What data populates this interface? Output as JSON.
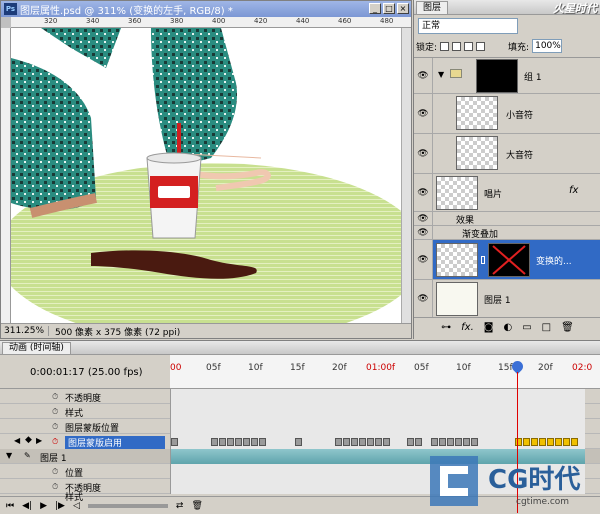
{
  "document": {
    "title": "图层属性.psd @ 311% (变换的左手, RGB/8) *",
    "app_icon": "Ps",
    "ruler_top_labels": [
      "320",
      "340",
      "360",
      "380",
      "400",
      "420",
      "440",
      "460",
      "480"
    ],
    "zoom": "311.25%",
    "status_info": "500 像素 x 375 像素 (72 ppi)"
  },
  "layers_panel": {
    "tab": "图层",
    "logo": "火星时代",
    "blend_mode": "正常",
    "lock_label": "锁定:",
    "fill_label": "填充:",
    "fill_value": "100%",
    "layers": [
      {
        "name": "组 1"
      },
      {
        "name": "小音符"
      },
      {
        "name": "大音符"
      },
      {
        "name": "唱片"
      },
      {
        "name": "效果"
      },
      {
        "name": "渐变叠加"
      },
      {
        "name": "变换的..."
      },
      {
        "name": "图层 1"
      }
    ],
    "fx_label": "fx"
  },
  "timeline": {
    "tab": "动画 (时间轴)",
    "current_time": "0:00:01:17",
    "fps": "(25.00 fps)",
    "ruler_labels": [
      "00",
      "05f",
      "10f",
      "15f",
      "20f",
      "01:00f",
      "05f",
      "10f",
      "15f",
      "20f",
      "02:0"
    ],
    "tracks": [
      {
        "label": "不透明度"
      },
      {
        "label": "样式"
      },
      {
        "label": "图层蒙版位置"
      },
      {
        "label": "图层蒙版启用"
      },
      {
        "label": "图层 1"
      },
      {
        "label": "位置"
      },
      {
        "label": "不透明度"
      },
      {
        "label": "样式"
      }
    ]
  },
  "watermark": {
    "brand": "CG时代",
    "url": "cgtime.com"
  },
  "colors": {
    "accent": "#316ac5",
    "playhead": "#e00000",
    "keyframe_active": "#f0c000",
    "dress": "#2a8c80",
    "ground": "#c8e090"
  }
}
